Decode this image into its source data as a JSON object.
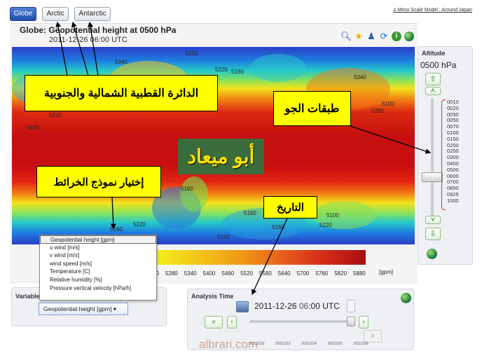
{
  "tabs": [
    {
      "label": "Globe",
      "active": true
    },
    {
      "label": "Arctic",
      "active": false
    },
    {
      "label": "Antarctic",
      "active": false
    }
  ],
  "top_link": "≥ Meso Scale Model : Around Japan",
  "map_title": "Globe: Geopotential height at 0500 hPa",
  "map_subtitle": "2011-12-26 06:00 UTC",
  "toolbar_icons": [
    "search-icon",
    "star-icon",
    "users-icon",
    "refresh-icon",
    "info-icon",
    "globe-icon"
  ],
  "contour_labels": [
    "5100",
    "5040",
    "5220",
    "5160",
    "5040",
    "5100",
    "5280",
    "5220",
    "5820",
    "5160",
    "5160",
    "5220",
    "5160",
    "5160",
    "5220",
    "5100",
    "5160"
  ],
  "scale": {
    "ticks": [
      "20",
      "5280",
      "5340",
      "5400",
      "5460",
      "5520",
      "5580",
      "5640",
      "5700",
      "5760",
      "5820",
      "5880"
    ],
    "unit": "[gpm]"
  },
  "altitude": {
    "label": "Altitude",
    "value": "0500 hPa",
    "levels": [
      "0010",
      "0020",
      "0030",
      "0050",
      "0070",
      "0100",
      "0150",
      "0200",
      "0250",
      "0300",
      "0400",
      "0500",
      "0600",
      "0700",
      "0850",
      "0925",
      "1000"
    ]
  },
  "variable": {
    "label": "Variable",
    "selected": "Geopotential height [gpm] ▾",
    "options": [
      "Geopotential height [gpm]",
      "u wind [m/s]",
      "v wind [m/s]",
      "wind speed [m/s]",
      "Temperature [C]",
      "Relative humidity [%]",
      "Pressure vertical velocity [hPa/h]"
    ]
  },
  "analysis_time": {
    "label": "Analysis Time",
    "date": "2011-12-26",
    "hour": "06",
    "rest": ":00 UTC",
    "ticks": [
      "20111222",
      "20111223",
      "20111224",
      "20111225",
      "20111226"
    ]
  },
  "annotations": {
    "poles": "الدائرة القطبية الشمالية والجنوبية",
    "layers": "طبقات الجو",
    "watermark": "أبو ميعاد",
    "model_choice": "إختيار نموذج الخرائط",
    "date": "التاريخ"
  },
  "watermark_site": "albrari.com",
  "colors": {
    "accent": "#1f4fa8",
    "annotation_bg": "#ffff00",
    "watermark_bg": "#3b6c3b",
    "watermark_text": "#ffe100"
  }
}
